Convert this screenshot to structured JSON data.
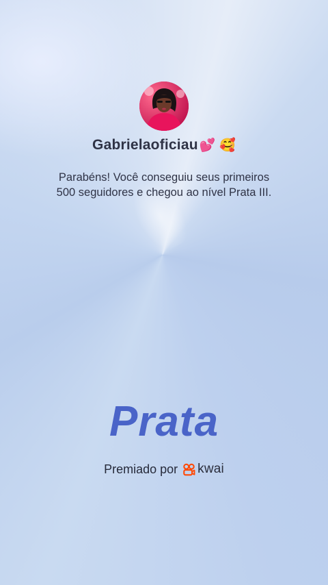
{
  "profile": {
    "username": "Gabrielaoficiau",
    "username_emoji": "💕 🥰",
    "avatar_icon": "profile-photo"
  },
  "message": {
    "line1": "Parabéns! Você conseguiu seus primeiros",
    "line2": "500 seguidores e chegou ao nível Prata III."
  },
  "level": {
    "name": "Prata"
  },
  "award": {
    "prefix": "Premiado por",
    "brand": "kwai",
    "brand_icon": "kwai-logo-icon",
    "brand_color": "#ff4906"
  },
  "colors": {
    "level_text": "#4a64c8",
    "text": "#2f3346"
  }
}
